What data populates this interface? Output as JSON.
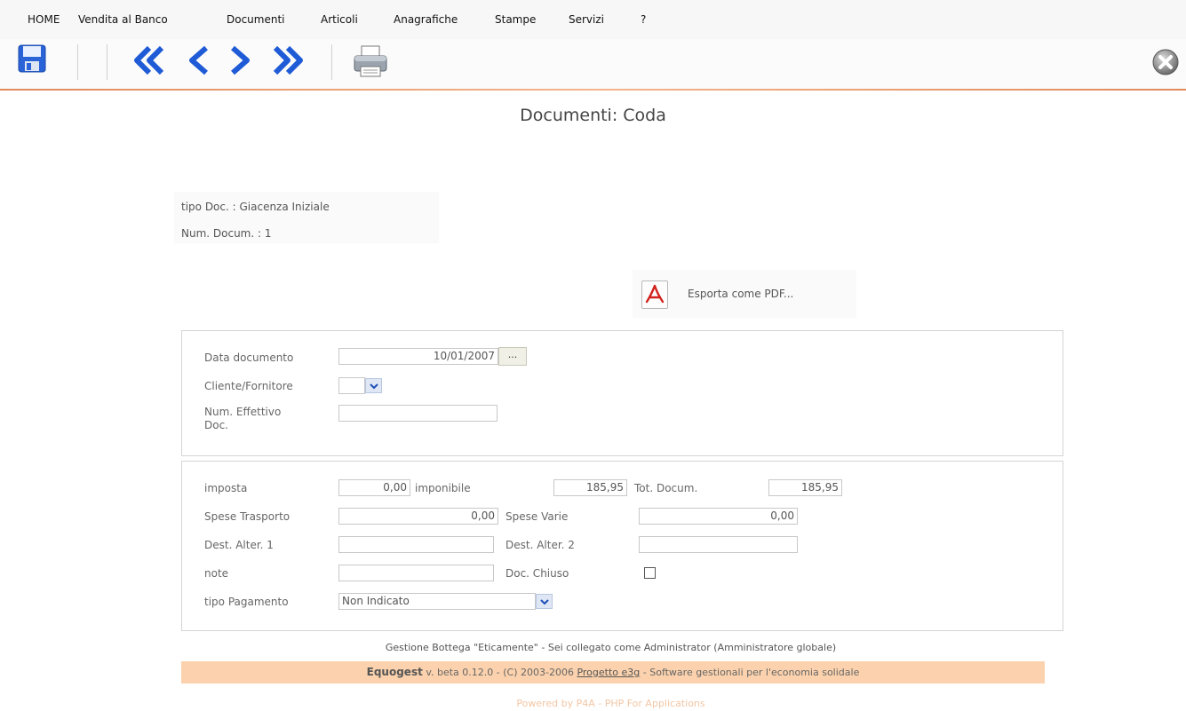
{
  "menu": {
    "items": [
      "HOME",
      "Vendita al Banco",
      "Documenti",
      "Articoli",
      "Anagrafiche",
      "Stampe",
      "Servizi",
      "?"
    ]
  },
  "toolbar": {
    "buttons": [
      {
        "name": "save-icon"
      },
      {
        "name": "first-record-icon"
      },
      {
        "name": "previous-record-icon"
      },
      {
        "name": "next-record-icon"
      },
      {
        "name": "last-record-icon"
      },
      {
        "name": "print-icon"
      },
      {
        "name": "close-icon"
      }
    ],
    "accent_color": "#1f5bd6",
    "line_color": "#e08a5a"
  },
  "page": {
    "title": "Documenti: Coda"
  },
  "doc_info": {
    "tipo": "tipo Doc. : Giacenza Iniziale",
    "num": "Num. Docum. : 1"
  },
  "export": {
    "label": "Esporta come PDF...",
    "icon": "pdf-icon"
  },
  "form1": {
    "data_documento_label": "Data documento",
    "data_documento_value": "10/01/2007",
    "calendar_button": "...",
    "cliente_label": "Cliente/Fornitore",
    "cliente_value": "",
    "num_effettivo_label_1": "Num. Effettivo",
    "num_effettivo_label_2": "Doc.",
    "num_effettivo_value": ""
  },
  "form2": {
    "imposta_label": "imposta",
    "imposta_value": "0,00",
    "imponibile_label": "imponibile",
    "imponibile_value": "185,95",
    "tot_label": "Tot. Docum.",
    "tot_value": "185,95",
    "spese_trasporto_label": "Spese Trasporto",
    "spese_trasporto_value": "0,00",
    "spese_varie_label": "Spese Varie",
    "spese_varie_value": "0,00",
    "dest1_label": "Dest. Alter. 1",
    "dest1_value": "",
    "dest2_label": "Dest. Alter. 2",
    "dest2_value": "",
    "note_label": "note",
    "note_value": "",
    "doc_chiuso_label": "Doc. Chiuso",
    "doc_chiuso_checked": false,
    "tipo_pagamento_label": "tipo Pagamento",
    "tipo_pagamento_value": "Non Indicato"
  },
  "footer": {
    "info": "Gestione Bottega \"Eticamente\" - Sei collegato come Administrator (Amministratore globale)",
    "app_name": "Equogest",
    "version": " v. beta 0.12.0 - (C) 2003-2006 ",
    "link": "Progetto e3g",
    "tagline": " - Software gestionali per l'economia solidale",
    "powered": "Powered by P4A - PHP For Applications",
    "bar_color": "#fbd2ad"
  }
}
